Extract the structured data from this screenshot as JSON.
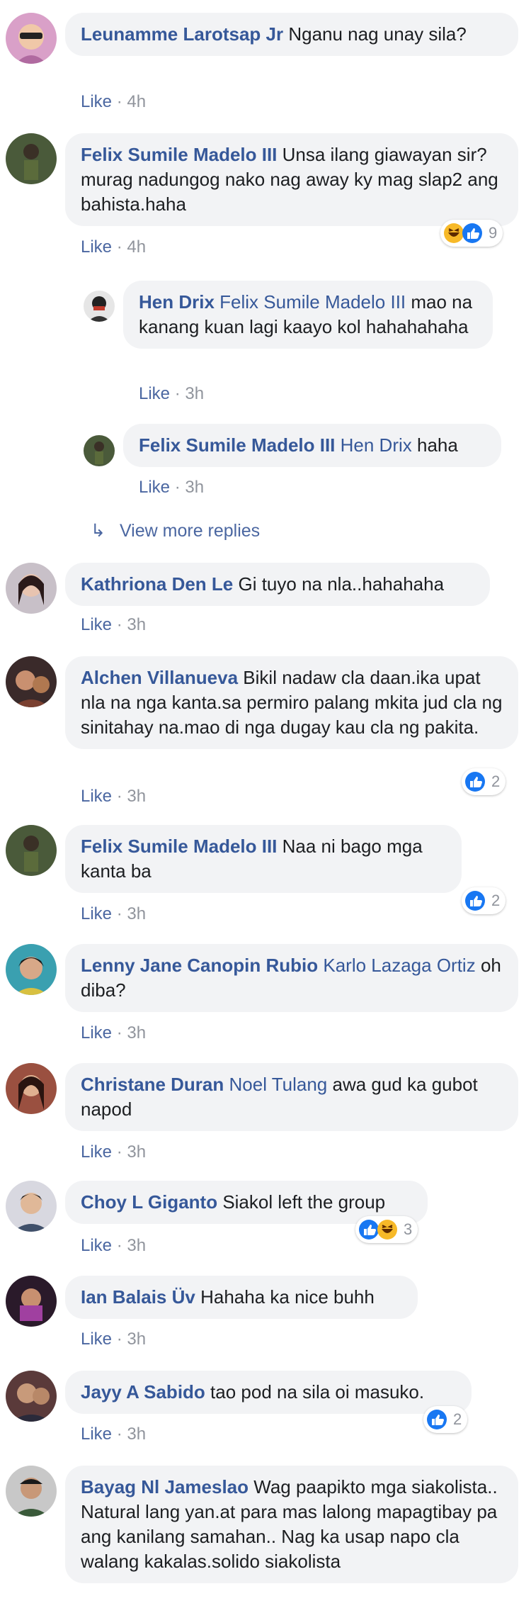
{
  "comments": [
    {
      "author": "Leunamme Larotsap Jr",
      "text": "Nganu nag unay sila?",
      "like": "Like",
      "time": "4h"
    },
    {
      "author": "Felix Sumile Madelo III",
      "text": "Unsa ilang giawayan sir?murag nadungog nako nag away ky mag slap2 ang bahista.haha",
      "like": "Like",
      "time": "4h",
      "reactions": {
        "icons": [
          "haha-icon",
          "like-icon"
        ],
        "count": "9"
      }
    },
    {
      "author": "Hen Drix",
      "tag": "Felix Sumile Madelo III",
      "text": "mao na kanang kuan lagi kaayo kol hahahahaha",
      "like": "Like",
      "time": "3h"
    },
    {
      "author": "Felix Sumile Madelo III",
      "tag": "Hen Drix",
      "text": "haha",
      "like": "Like",
      "time": "3h"
    },
    {
      "author": "Kathriona Den Le",
      "text": "Gi tuyo na nla..hahahaha",
      "like": "Like",
      "time": "3h"
    },
    {
      "author": "Alchen Villanueva",
      "text": "Bikil nadaw cla daan.ika upat nla na nga kanta.sa permiro palang mkita jud cla ng sinitahay na.mao di nga dugay kau cla ng pakita.",
      "like": "Like",
      "time": "3h",
      "reactions": {
        "icons": [
          "like-icon"
        ],
        "count": "2"
      }
    },
    {
      "author": "Felix Sumile Madelo III",
      "text": "Naa ni bago mga kanta ba",
      "like": "Like",
      "time": "3h",
      "reactions": {
        "icons": [
          "like-icon"
        ],
        "count": "2"
      }
    },
    {
      "author": "Lenny Jane Canopin Rubio",
      "tag": "Karlo Lazaga Ortiz",
      "text": "oh diba?",
      "like": "Like",
      "time": "3h"
    },
    {
      "author": "Christane Duran",
      "tag": "Noel Tulang",
      "text": "awa gud ka gubot napod",
      "like": "Like",
      "time": "3h"
    },
    {
      "author": "Choy L Giganto",
      "text": "Siakol left the group",
      "like": "Like",
      "time": "3h",
      "reactions": {
        "icons": [
          "like-icon",
          "haha-icon"
        ],
        "count": "3"
      }
    },
    {
      "author": "Ian Balais Üv",
      "text": "Hahaha ka nice buhh",
      "like": "Like",
      "time": "3h"
    },
    {
      "author": "Jayy A Sabido",
      "text": "tao pod na sila oi masuko.",
      "like": "Like",
      "time": "3h",
      "reactions": {
        "icons": [
          "like-icon"
        ],
        "count": "2"
      }
    },
    {
      "author": "Bayag Nl Jameslao",
      "text": "Wag paapikto mga siakolista.. Natural lang yan.at para mas lalong mapagtibay pa ang kanilang samahan.. Nag ka usap napo cla walang kakalas.solido siakolista"
    }
  ],
  "view_more": "View more replies",
  "separator": "·",
  "colors": {
    "name": "#365899",
    "like": "#4b67a1",
    "meta": "#90949c",
    "bubble": "#f2f3f5",
    "like_react": "#1877f2",
    "haha_react": "#f7b928"
  }
}
